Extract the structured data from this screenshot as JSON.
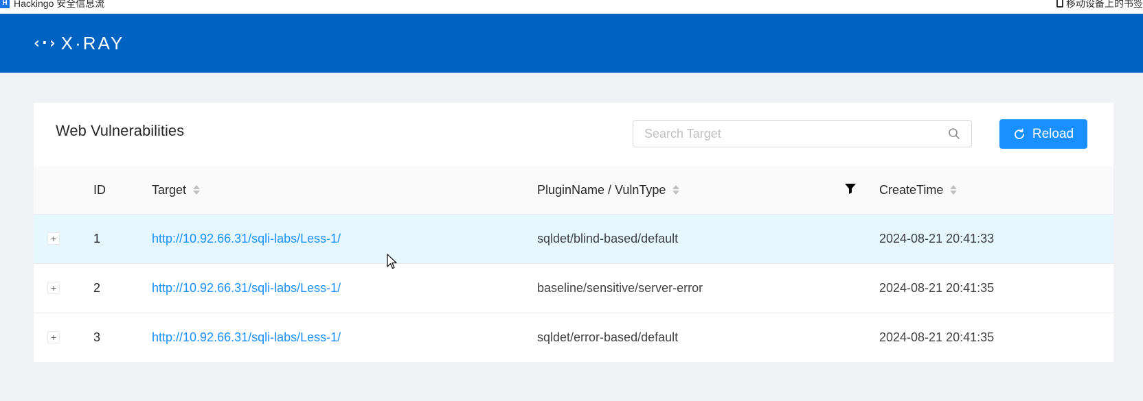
{
  "bookmarks": {
    "left_label": "Hackingo 安全信息流",
    "favicon_letter": "H",
    "right_label": "移动设备上的书签"
  },
  "header": {
    "logo_mark": "‹·›",
    "logo_text": "X·RAY"
  },
  "panel": {
    "title": "Web Vulnerabilities",
    "search_placeholder": "Search Target",
    "reload_label": "Reload"
  },
  "table": {
    "columns": {
      "id": "ID",
      "target": "Target",
      "plugin": "PluginName / VulnType",
      "create_time": "CreateTime"
    },
    "rows": [
      {
        "expand": "+",
        "id": "1",
        "target": "http://10.92.66.31/sqli-labs/Less-1/",
        "plugin": "sqldet/blind-based/default",
        "create_time": "2024-08-21 20:41:33"
      },
      {
        "expand": "+",
        "id": "2",
        "target": "http://10.92.66.31/sqli-labs/Less-1/",
        "plugin": "baseline/sensitive/server-error",
        "create_time": "2024-08-21 20:41:35"
      },
      {
        "expand": "+",
        "id": "3",
        "target": "http://10.92.66.31/sqli-labs/Less-1/",
        "plugin": "sqldet/error-based/default",
        "create_time": "2024-08-21 20:41:35"
      }
    ]
  },
  "colors": {
    "header_bg": "#0063c1",
    "primary": "#1890ff",
    "row_hover": "#e6f7ff"
  },
  "icons": [
    "search-icon",
    "reload-icon",
    "filter-icon",
    "sort-icon",
    "cursor-icon"
  ]
}
